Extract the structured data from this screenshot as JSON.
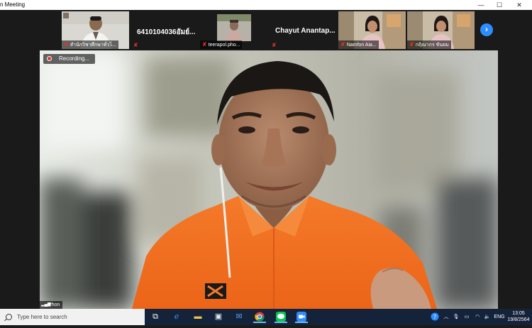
{
  "window": {
    "title": "n Meeting",
    "minimize_glyph": "—",
    "maximize_glyph": "☐",
    "close_glyph": "✕"
  },
  "thumbnails": [
    {
      "name": "สำนักวิชาศึกษาทั่วไ..."
    },
    {
      "name": "6410104036อัมย์..."
    },
    {
      "name": "teerapol.pho..."
    },
    {
      "name": "Chayut  Anantap..."
    },
    {
      "name": "Namfon Aia..."
    },
    {
      "name": "กฤิณากร ขันยม"
    }
  ],
  "next_page_glyph": "›",
  "main_video": {
    "recording_label": "Recording...",
    "speaker_name": "Phon"
  },
  "taskbar": {
    "search_placeholder": "Type here to search",
    "language": "ENG",
    "time": "13:05",
    "date": "19/8/2564",
    "icons": [
      "task-view-icon",
      "edge-icon",
      "file-explorer-icon",
      "store-icon",
      "mail-icon",
      "chrome-icon",
      "line-icon",
      "zoom-icon"
    ]
  },
  "colors": {
    "zoom_blue": "#2d8cff",
    "muted_red": "#e0342e",
    "taskbar": "#15233a",
    "shirt_orange": "#f26d21"
  }
}
